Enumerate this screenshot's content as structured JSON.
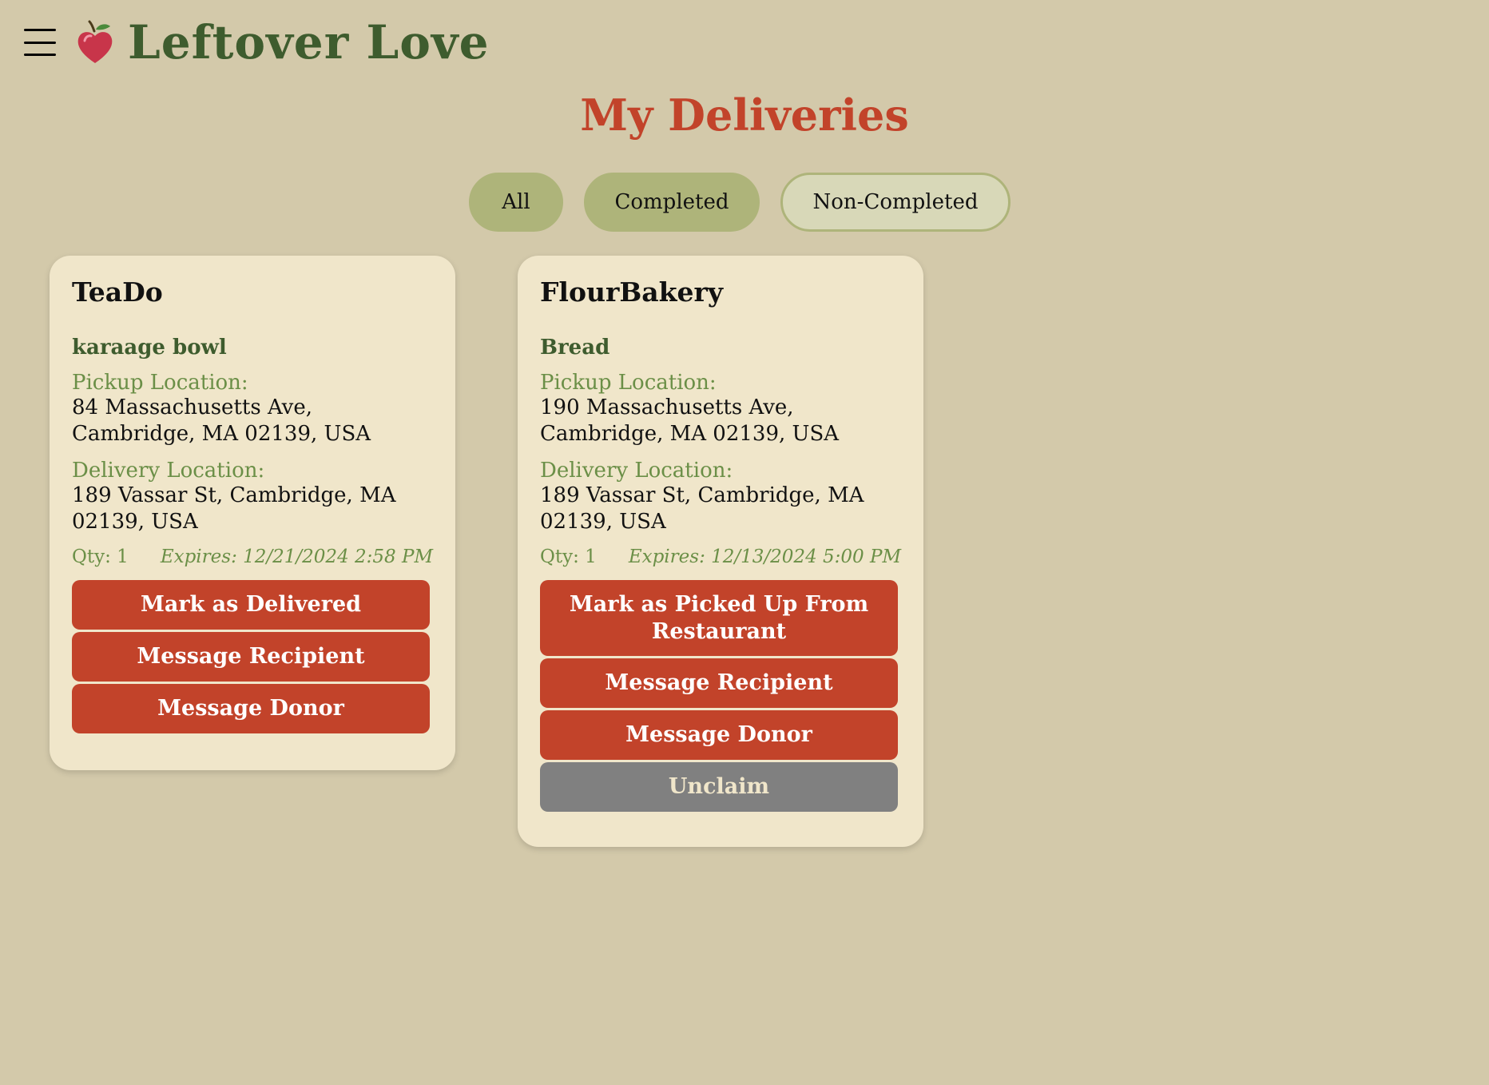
{
  "app": {
    "title": "Leftover Love"
  },
  "page": {
    "title": "My Deliveries"
  },
  "filters": [
    {
      "label": "All",
      "active": true
    },
    {
      "label": "Completed",
      "active": true
    },
    {
      "label": "Non-Completed",
      "active": false
    }
  ],
  "cards": [
    {
      "restaurant": "TeaDo",
      "food": "karaage bowl",
      "pickup_label": "Pickup Location:",
      "pickup_address": "84 Massachusetts Ave, Cambridge, MA 02139, USA",
      "delivery_label": "Delivery Location:",
      "delivery_address": "189 Vassar St, Cambridge, MA 02139, USA",
      "qty": "Qty: 1",
      "expires": "Expires: 12/21/2024 2:58 PM",
      "buttons": [
        "Mark as Delivered",
        "Message Recipient",
        "Message Donor"
      ]
    },
    {
      "restaurant": "FlourBakery",
      "food": "Bread",
      "pickup_label": "Pickup Location:",
      "pickup_address": "190 Massachusetts Ave, Cambridge, MA 02139, USA",
      "delivery_label": "Delivery Location:",
      "delivery_address": "189 Vassar St, Cambridge, MA 02139, USA",
      "qty": "Qty: 1",
      "expires": "Expires: 12/13/2024 5:00 PM",
      "buttons": [
        "Mark as Picked Up From Restaurant",
        "Message Recipient",
        "Message Donor",
        "Unclaim"
      ]
    }
  ],
  "colors": {
    "background": "#d3c9aa",
    "card": "#f0e6ca",
    "accent_red": "#c2432a",
    "brand_green": "#3e5c2e",
    "label_green": "#6b8f47",
    "pill_active": "#aeb47a",
    "unclaim_gray": "#808080"
  },
  "icons": {
    "menu": "hamburger-menu-icon",
    "logo": "apple-heart-icon"
  }
}
